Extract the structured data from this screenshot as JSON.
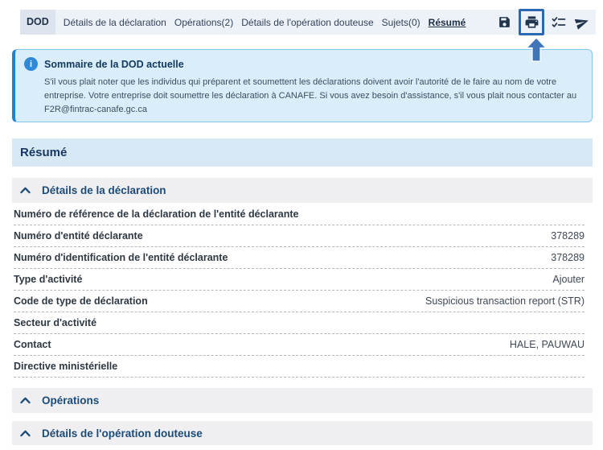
{
  "nav": {
    "items": [
      {
        "label": "DOD"
      },
      {
        "label": "Détails de la déclaration"
      },
      {
        "label": "Opérations(2)"
      },
      {
        "label": "Détails de l'opération douteuse"
      },
      {
        "label": "Sujets(0)"
      },
      {
        "label": "Résumé"
      }
    ],
    "active": "Résumé"
  },
  "toolbar": {
    "icons": [
      "save-icon",
      "print-icon",
      "checklist-icon",
      "send-icon"
    ],
    "highlighted_icon": "print-icon"
  },
  "banner": {
    "title": "Sommaire de la DOD actuelle",
    "body": "S'il vous plait noter que les individus qui préparent et soumettent les déclarations doivent avoir l'autorité de le faire au nom de votre entreprise. Votre entreprise doit soumettre les déclaration à CANAFE. Si vous avez besoin d'assistance, s'il vous plait nous contacter au F2R@fintrac-canafe.gc.ca"
  },
  "page_title": "Résumé",
  "sections": [
    {
      "title": "Détails de la déclaration",
      "rows": [
        {
          "label": "Numéro de référence de la déclaration de l'entité déclarante",
          "value": ""
        },
        {
          "label": "Numéro d'entité déclarante",
          "value": "378289"
        },
        {
          "label": "Numéro d'identification de l'entité déclarante",
          "value": "378289"
        },
        {
          "label": "Type d'activité",
          "value": "Ajouter"
        },
        {
          "label": "Code de type de déclaration",
          "value": "Suspicious transaction report (STR)"
        },
        {
          "label": "Secteur d'activité",
          "value": ""
        },
        {
          "label": "Contact",
          "value": "HALE, PAUWAU"
        },
        {
          "label": "Directive ministérielle",
          "value": ""
        }
      ]
    },
    {
      "title": "Opérations"
    },
    {
      "title": "Détails de l'opération douteuse"
    }
  ],
  "colors": {
    "accent_blue": "#1b85d5",
    "highlight_border": "#2c68b2",
    "banner_bg": "#d9edfa",
    "page_header_bg": "#d8e9f6",
    "section_bg": "#efeff1",
    "tabbar_bg": "#edf2f8"
  }
}
